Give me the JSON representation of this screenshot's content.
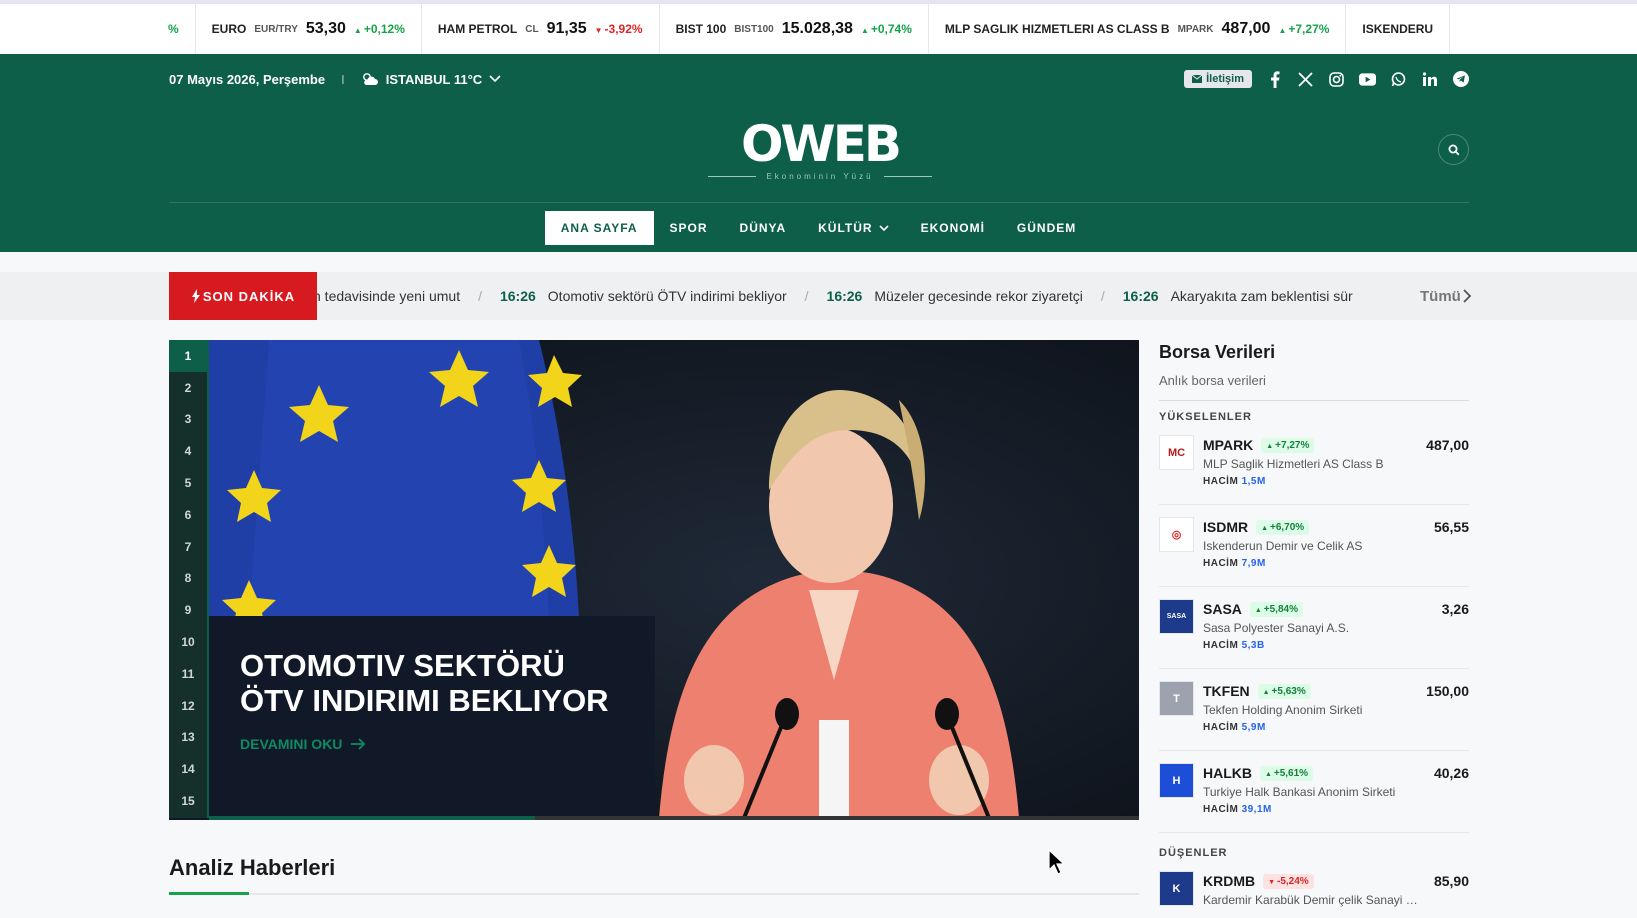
{
  "ticker": [
    {
      "name": "",
      "code": "",
      "price": "",
      "change": "%",
      "dir": "up"
    },
    {
      "name": "EURO",
      "code": "EUR/TRY",
      "price": "53,30",
      "change": "+0,12%",
      "dir": "up"
    },
    {
      "name": "HAM PETROL",
      "code": "CL",
      "price": "91,35",
      "change": "-3,92%",
      "dir": "down"
    },
    {
      "name": "BIST 100",
      "code": "BIST100",
      "price": "15.028,38",
      "change": "+0,74%",
      "dir": "up"
    },
    {
      "name": "MLP SAGLIK HIZMETLERI AS CLASS B",
      "code": "MPARK",
      "price": "487,00",
      "change": "+7,27%",
      "dir": "up"
    },
    {
      "name": "ISKENDERU",
      "code": "",
      "price": "",
      "change": "",
      "dir": "up"
    }
  ],
  "topbar": {
    "date": "07 Mayıs 2026, Perşembe",
    "divider": "I",
    "weather": "ISTANBUL 11°C",
    "contact": "İletişim"
  },
  "logo": {
    "main": "OWEB",
    "tagline": "Ekonominin Yüzü"
  },
  "nav": [
    {
      "label": "ANA SAYFA",
      "active": true
    },
    {
      "label": "SPOR"
    },
    {
      "label": "DÜNYA"
    },
    {
      "label": "KÜLTÜR",
      "dropdown": true
    },
    {
      "label": "EKONOMİ"
    },
    {
      "label": "GÜNDEM"
    }
  ],
  "breaking": {
    "label": "SON DAKİKA",
    "all": "Tümü",
    "items": [
      {
        "time": "",
        "text": "n tedavisinde yeni umut"
      },
      {
        "time": "16:26",
        "text": "Otomotiv sektörü ÖTV indirimi bekliyor"
      },
      {
        "time": "16:26",
        "text": "Müzeler gecesinde rekor ziyaretçi"
      },
      {
        "time": "16:26",
        "text": "Akaryakıta zam beklentisi sür"
      }
    ]
  },
  "slider": {
    "pages": [
      "1",
      "2",
      "3",
      "4",
      "5",
      "6",
      "7",
      "8",
      "9",
      "10",
      "11",
      "12",
      "13",
      "14",
      "15"
    ],
    "active": 0,
    "title": "OTOMOTIV SEKTÖRÜ ÖTV INDIRIMI BEKLIYOR",
    "more": "DEVAMINI OKU",
    "progress": 0.35
  },
  "analysis": {
    "title": "Analiz Haberleri"
  },
  "stocks": {
    "title": "Borsa Verileri",
    "subtitle": "Anlık borsa verileri",
    "rising_label": "YÜKSELENLER",
    "falling_label": "DÜŞENLER",
    "volume_label": "HACİM",
    "rising": [
      {
        "code": "MPARK",
        "change": "+7,27%",
        "name": "MLP Saglik Hizmetleri AS Class B",
        "volume": "1,5M",
        "price": "487,00",
        "logo": "MC",
        "logo_color": "#b91c1c"
      },
      {
        "code": "ISDMR",
        "change": "+6,70%",
        "name": "Iskenderun Demir ve Celik AS",
        "volume": "7,9M",
        "price": "56,55",
        "logo": "◎",
        "logo_color": "#dc2626"
      },
      {
        "code": "SASA",
        "change": "+5,84%",
        "name": "Sasa Polyester Sanayi A.S.",
        "volume": "5,3B",
        "price": "3,26",
        "logo": "SASA",
        "logo_color": "#1e3a8a"
      },
      {
        "code": "TKFEN",
        "change": "+5,63%",
        "name": "Tekfen Holding Anonim Sirketi",
        "volume": "5,9M",
        "price": "150,00",
        "logo": "T",
        "logo_color": "#9ca3af"
      },
      {
        "code": "HALKB",
        "change": "+5,61%",
        "name": "Turkiye Halk Bankasi Anonim Sirketi",
        "volume": "39,1M",
        "price": "40,26",
        "logo": "H",
        "logo_color": "#1d4ed8"
      }
    ],
    "falling": [
      {
        "code": "KRDMB",
        "change": "-5,24%",
        "name": "Kardemir Karabük Demir çelik Sanayi ve Ticaret",
        "volume": "",
        "price": "85,90",
        "logo": "K",
        "logo_color": "#1e3a8a"
      }
    ]
  }
}
